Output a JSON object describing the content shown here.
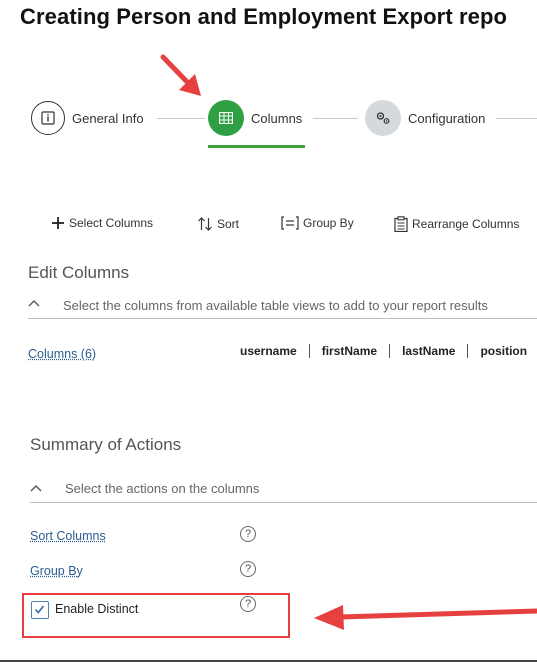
{
  "page": {
    "title": "Creating Person and Employment Export repo"
  },
  "stepper": {
    "steps": [
      {
        "label": "General Info"
      },
      {
        "label": "Columns"
      },
      {
        "label": "Configuration"
      }
    ]
  },
  "toolbar": {
    "select_columns": "Select Columns",
    "sort": "Sort",
    "group_by": "Group By",
    "rearrange_columns": "Rearrange Columns"
  },
  "edit_columns": {
    "title": "Edit Columns",
    "hint": "Select the columns from available table views to add to your report results",
    "columns_link": "Columns (6)",
    "column_names": [
      "username",
      "firstName",
      "lastName",
      "position"
    ]
  },
  "summary": {
    "title": "Summary of Actions",
    "hint": "Select the actions on the columns",
    "sort_columns": "Sort Columns",
    "group_by": "Group By",
    "enable_distinct": "Enable Distinct",
    "enable_distinct_checked": true,
    "help_glyph": "?"
  },
  "colors": {
    "active_step": "#2ea043",
    "annotation_red": "#e74040",
    "link": "#2a5d8f"
  },
  "icons": [
    "info-icon",
    "table-grid-icon",
    "gears-icon",
    "plus-icon",
    "sort-arrows-icon",
    "group-by-icon",
    "clipboard-icon",
    "chevron-up-icon",
    "help-icon",
    "checkmark-icon",
    "red-arrow-icon"
  ]
}
